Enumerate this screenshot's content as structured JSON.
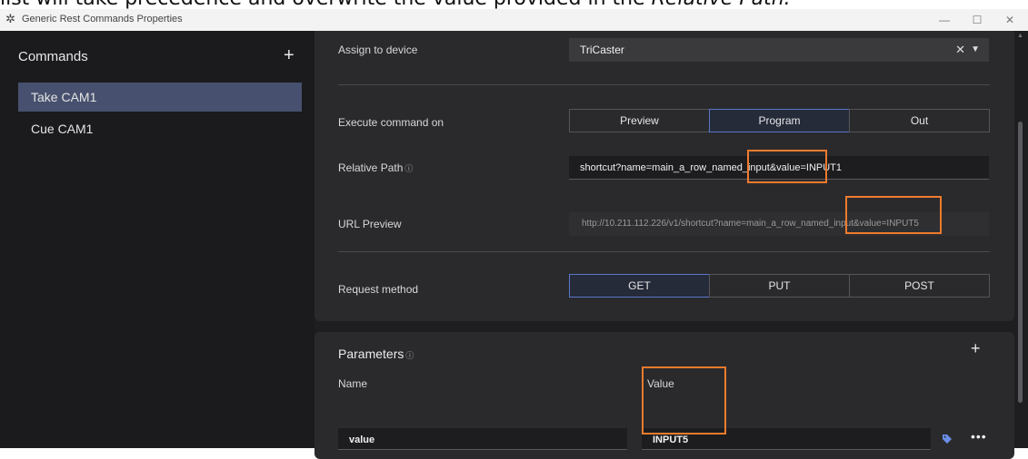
{
  "doc": {
    "prefix": "list will take precedence and overwrite the value provided in the ",
    "emphasis": "Relative Path."
  },
  "window": {
    "title": "Generic Rest Commands Properties",
    "minimize": "—",
    "maximize": "☐",
    "close": "✕"
  },
  "sidebar": {
    "title": "Commands",
    "add": "+",
    "items": [
      {
        "label": "Take CAM1",
        "active": true
      },
      {
        "label": "Cue CAM1",
        "active": false
      }
    ]
  },
  "main": {
    "assign": {
      "label": "Assign to device",
      "value": "TriCaster",
      "clear": "✕",
      "caret": "▼"
    },
    "execute": {
      "label": "Execute command on",
      "options": [
        "Preview",
        "Program",
        "Out"
      ],
      "selected": "Program"
    },
    "relative_path": {
      "label": "Relative Path",
      "help": "ⓘ",
      "value": "shortcut?name=main_a_row_named_input&value=INPUT1"
    },
    "url_preview": {
      "label": "URL Preview",
      "value": "http://10.211.112.226/v1/shortcut?name=main_a_row_named_input&value=INPUT5"
    },
    "request_method": {
      "label": "Request method",
      "options": [
        "GET",
        "PUT",
        "POST"
      ],
      "selected": "GET"
    }
  },
  "parameters": {
    "title": "Parameters",
    "help": "ⓘ",
    "add": "+",
    "name_header": "Name",
    "value_header": "Value",
    "row": {
      "name": "value",
      "value": "INPUT5",
      "more": "•••"
    }
  },
  "colors": {
    "highlight": "#ef7b2c",
    "selected_border": "#5a78c8",
    "sidebar_active": "#47516f",
    "tag_icon": "#6b8fe8"
  }
}
